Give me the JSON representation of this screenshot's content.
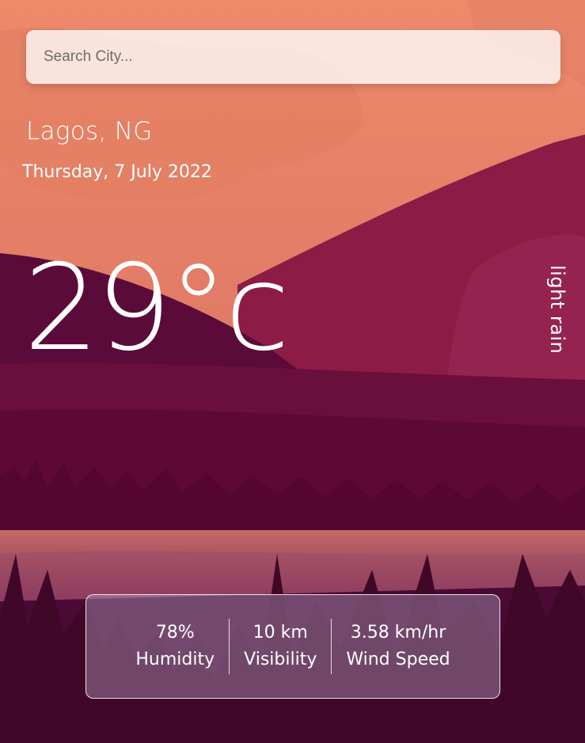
{
  "search": {
    "placeholder": "Search City..."
  },
  "location": {
    "city": "Lagos, NG",
    "date": "Thursday, 7 July 2022"
  },
  "weather": {
    "temperature": "29°c",
    "condition": "light rain"
  },
  "stats": [
    {
      "value": "78%",
      "label": "Humidity"
    },
    {
      "value": "10 km",
      "label": "Visibility"
    },
    {
      "value": "3.58 km/hr",
      "label": "Wind Speed"
    }
  ],
  "colors": {
    "sky_top": "#ee8a6a",
    "mountain": "#8a1a45",
    "hill_dark": "#5a0a38",
    "ground": "#4a0a33"
  }
}
